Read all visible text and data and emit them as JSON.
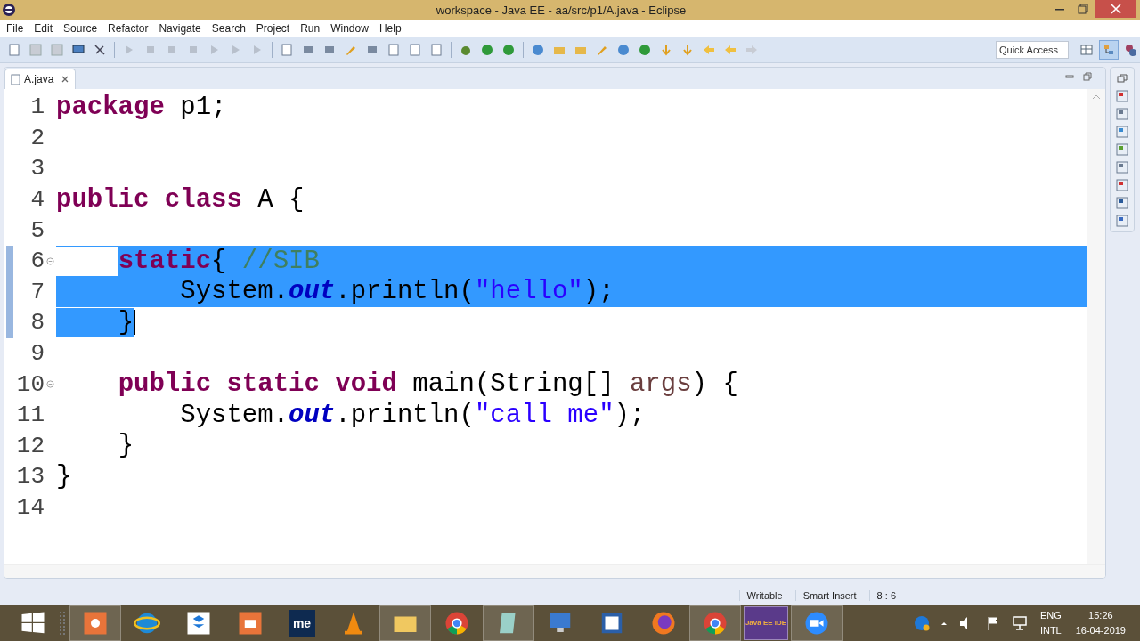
{
  "window": {
    "title": "workspace - Java EE - aa/src/p1/A.java - Eclipse"
  },
  "menu": [
    "File",
    "Edit",
    "Source",
    "Refactor",
    "Navigate",
    "Search",
    "Project",
    "Run",
    "Window",
    "Help"
  ],
  "quick_access": {
    "placeholder": "Quick Access"
  },
  "tabs": [
    {
      "label": "A.java",
      "selected": true
    }
  ],
  "lines": [
    {
      "number": "1",
      "selected": false,
      "tokens": [
        {
          "kind": "keyword",
          "text": "package"
        },
        {
          "kind": "plain",
          "text": " p1;"
        }
      ]
    },
    {
      "number": "2",
      "selected": false
    },
    {
      "number": "3",
      "selected": false
    },
    {
      "number": "4",
      "selected": false,
      "tokens": [
        {
          "kind": "keyword",
          "text": "public"
        },
        {
          "kind": "keyword",
          "text": " class"
        },
        {
          "kind": "plain",
          "text": " A {"
        }
      ]
    },
    {
      "number": "5",
      "selected": false
    },
    {
      "number": "6",
      "selected": true,
      "foldable": true,
      "tokens": [
        {
          "kind": "keyword",
          "text": "    static"
        },
        {
          "kind": "plain",
          "text": "{ "
        },
        {
          "kind": "comment",
          "text": "//SIB"
        }
      ]
    },
    {
      "number": "7",
      "selected": true,
      "tokens": [
        {
          "kind": "plain",
          "text": "        System."
        },
        {
          "kind": "field",
          "text": "out"
        },
        {
          "kind": "plain",
          "text": ".println("
        },
        {
          "kind": "string",
          "text": "\"hello\""
        },
        {
          "kind": "plain",
          "text": ");"
        }
      ]
    },
    {
      "number": "8",
      "selected": true,
      "cursor": true,
      "tokens": [
        {
          "kind": "plain",
          "text": "    }"
        }
      ]
    },
    {
      "number": "9",
      "selected": false
    },
    {
      "number": "10",
      "selected": false,
      "foldable": true,
      "tokens": [
        {
          "kind": "keyword",
          "text": "    public"
        },
        {
          "kind": "keyword",
          "text": " static"
        },
        {
          "kind": "keyword",
          "text": " void"
        },
        {
          "kind": "plain",
          "text": " main(String[] "
        },
        {
          "kind": "param",
          "text": "args"
        },
        {
          "kind": "plain",
          "text": ") {"
        }
      ]
    },
    {
      "number": "11",
      "selected": false,
      "tokens": [
        {
          "kind": "plain",
          "text": "        System."
        },
        {
          "kind": "field",
          "text": "out"
        },
        {
          "kind": "plain",
          "text": ".println("
        },
        {
          "kind": "string",
          "text": "\"call me\""
        },
        {
          "kind": "plain",
          "text": ");"
        }
      ]
    },
    {
      "number": "12",
      "selected": false,
      "tokens": [
        {
          "kind": "plain",
          "text": "    }"
        }
      ]
    },
    {
      "number": "13",
      "selected": false,
      "tokens": [
        {
          "kind": "plain",
          "text": "}"
        }
      ]
    },
    {
      "number": "14",
      "selected": false
    }
  ],
  "status_bar": [
    "Writable",
    "Smart Insert",
    "8 : 6"
  ],
  "taskbar": {
    "me_label": "me",
    "eclipse_label": "Java EE IDE",
    "language": "ENG",
    "layout": "INTL",
    "time": "15:26",
    "date": "16-04-2019"
  }
}
